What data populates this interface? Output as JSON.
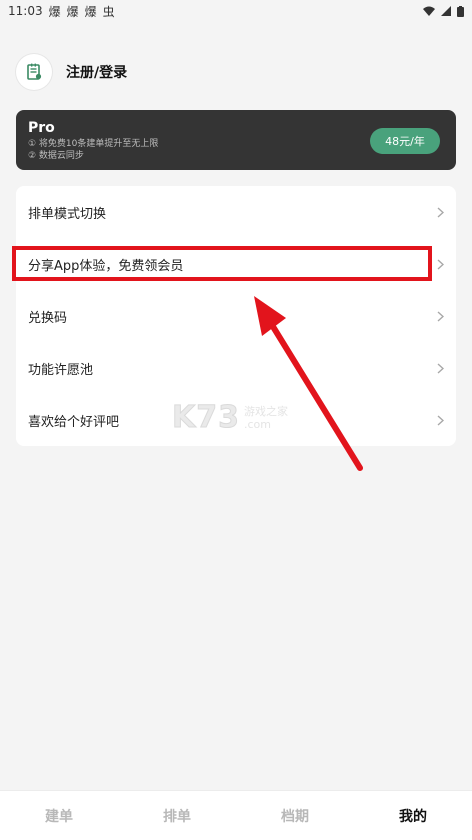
{
  "status_bar": {
    "time": "11:03",
    "app_icons": [
      "爆",
      "爆",
      "爆",
      "虫"
    ],
    "wifi_icon": "wifi-icon",
    "signal_icon": "signal-icon",
    "battery_icon": "battery-icon"
  },
  "profile": {
    "login_label": "注册/登录",
    "avatar_icon": "notebook-icon"
  },
  "pro": {
    "title": "Pro",
    "features": [
      "① 将免费10条建单提升至无上限",
      "② 数据云同步"
    ],
    "price_label": "48元/年"
  },
  "menu": {
    "items": [
      {
        "label": "排单模式切换"
      },
      {
        "label": "分享App体验，免费领会员"
      },
      {
        "label": "兑换码"
      },
      {
        "label": "功能许愿池"
      },
      {
        "label": "喜欢给个好评吧"
      }
    ]
  },
  "watermark": {
    "brand": "K73",
    "line1": "游戏之家",
    "line2": ".com"
  },
  "tabs": [
    {
      "label": "建单",
      "active": false
    },
    {
      "label": "排单",
      "active": false
    },
    {
      "label": "档期",
      "active": false
    },
    {
      "label": "我的",
      "active": true
    }
  ],
  "colors": {
    "pro_bg": "#343434",
    "price_button": "#49a27c",
    "highlight": "#e2141c",
    "arrow": "#e2141c"
  }
}
